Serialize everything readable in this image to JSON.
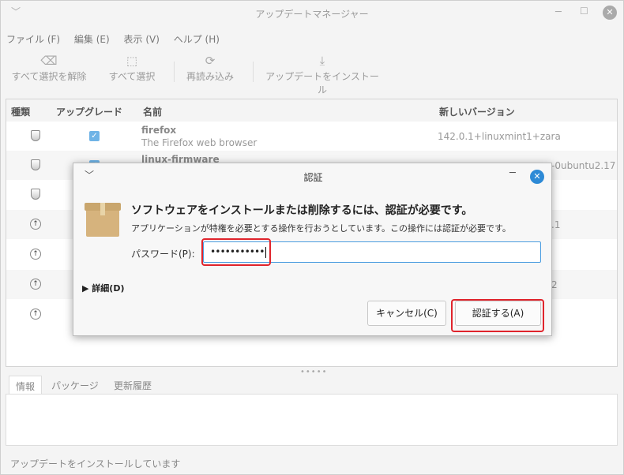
{
  "window": {
    "title": "アップデートマネージャー",
    "chevron": "﹀",
    "min": "─",
    "max": "☐",
    "close": "✕"
  },
  "menu": [
    "ファイル (F)",
    "編集 (E)",
    "表示 (V)",
    "ヘルプ (H)"
  ],
  "toolbar": [
    {
      "icon": "clear-selection-icon",
      "glyph": "⌫",
      "label": "すべて選択を解除"
    },
    {
      "icon": "select-all-icon",
      "glyph": "⬚",
      "label": "すべて選択"
    },
    {
      "icon": "refresh-icon",
      "glyph": "⟳",
      "label": "再読み込み"
    },
    {
      "icon": "download-install-icon",
      "glyph": "⤓",
      "label": "アップデートをインストール"
    }
  ],
  "list": {
    "headers": {
      "type": "種類",
      "upgrade": "アップグレード",
      "name": "名前",
      "new_version": "新しいバージョン"
    },
    "rows": [
      {
        "type": "security",
        "name": "firefox",
        "desc": "The Firefox web browser",
        "version": "142.0.1+linuxmint1+zara"
      },
      {
        "type": "security",
        "name": "linux-firmware",
        "desc": "",
        "version": "-0ubuntu2.17"
      },
      {
        "type": "security",
        "name": "",
        "desc": "",
        "version": ""
      },
      {
        "type": "update",
        "name": "",
        "desc": "",
        "version": ".1"
      },
      {
        "type": "update",
        "name": "",
        "desc": "",
        "version": ""
      },
      {
        "type": "update",
        "name": "",
        "desc": "",
        "version": "2"
      },
      {
        "type": "update",
        "name": "",
        "desc": "",
        "version": ""
      }
    ]
  },
  "tabs": [
    "情報",
    "パッケージ",
    "更新履歴"
  ],
  "status": "アップデートをインストールしています",
  "dialog": {
    "title": "認証",
    "heading": "ソフトウェアをインストールまたは削除するには、認証が必要です。",
    "subtext": "アプリケーションが特権を必要とする操作を行おうとしています。この操作には認証が必要です。",
    "password_label": "パスワード(P):",
    "password_value": "•••••••••••",
    "details_label": "詳細(D)",
    "cancel_label": "キャンセル(C)",
    "auth_label": "認証する(A)",
    "close": "✕",
    "min": "─",
    "chevron": "﹀"
  }
}
